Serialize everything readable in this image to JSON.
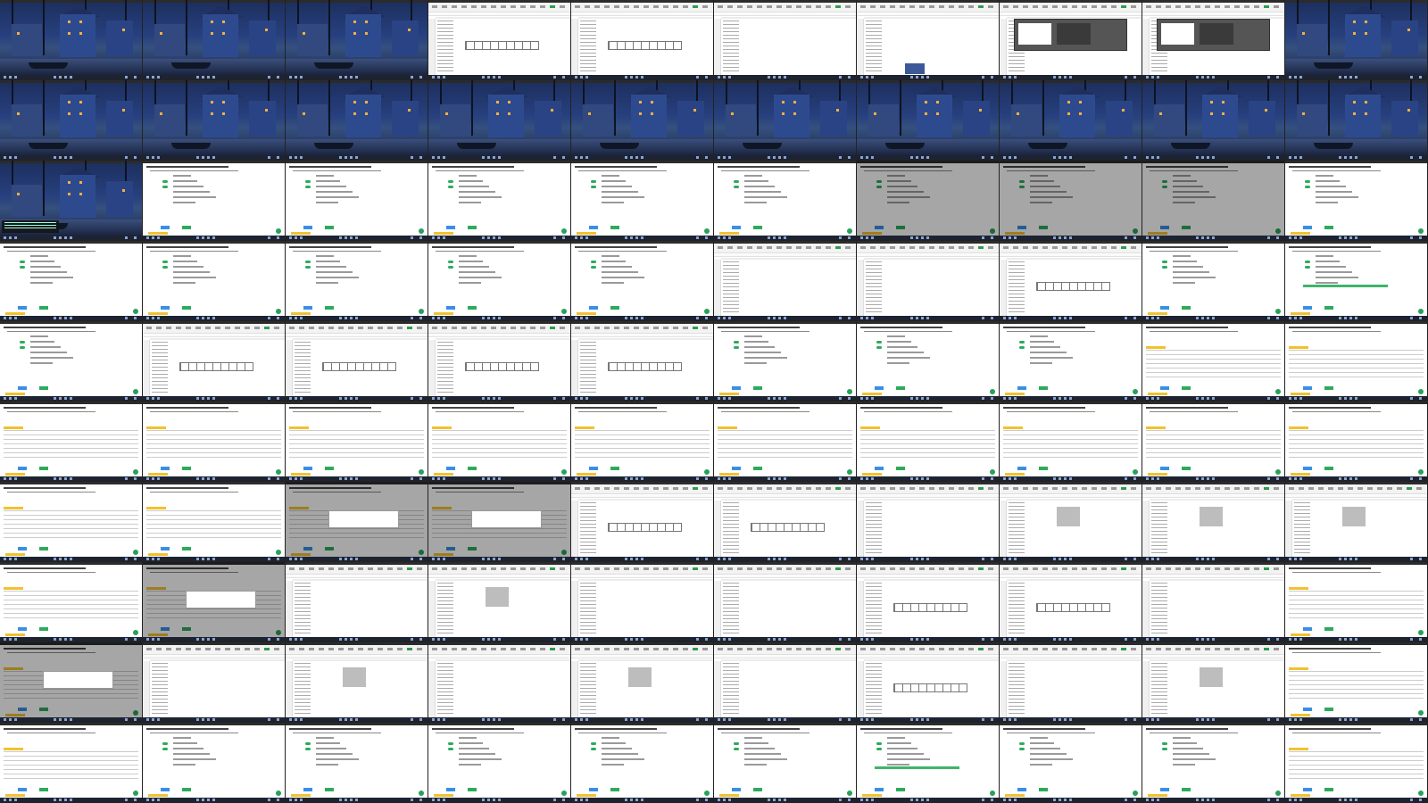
{
  "grid": {
    "frames": [
      {
        "kind": "desktop"
      },
      {
        "kind": "desktop"
      },
      {
        "kind": "desktop"
      },
      {
        "kind": "sheet",
        "variant": "table"
      },
      {
        "kind": "sheet",
        "variant": "table"
      },
      {
        "kind": "sheet",
        "variant": "plain"
      },
      {
        "kind": "sheet",
        "variant": "thumb"
      },
      {
        "kind": "sheet",
        "variant": "dialog"
      },
      {
        "kind": "sheet",
        "variant": "dialog"
      },
      {
        "kind": "desktop"
      },
      {
        "kind": "desktop"
      },
      {
        "kind": "desktop"
      },
      {
        "kind": "desktop"
      },
      {
        "kind": "desktop"
      },
      {
        "kind": "desktop"
      },
      {
        "kind": "desktop"
      },
      {
        "kind": "desktop"
      },
      {
        "kind": "desktop"
      },
      {
        "kind": "desktop"
      },
      {
        "kind": "desktop"
      },
      {
        "kind": "desktop",
        "variant": "term"
      },
      {
        "kind": "form"
      },
      {
        "kind": "form"
      },
      {
        "kind": "form"
      },
      {
        "kind": "form"
      },
      {
        "kind": "form"
      },
      {
        "kind": "form",
        "variant": "shade"
      },
      {
        "kind": "form",
        "variant": "shade"
      },
      {
        "kind": "form",
        "variant": "shade"
      },
      {
        "kind": "form"
      },
      {
        "kind": "form"
      },
      {
        "kind": "form"
      },
      {
        "kind": "form"
      },
      {
        "kind": "form"
      },
      {
        "kind": "form"
      },
      {
        "kind": "sheet",
        "variant": "plain"
      },
      {
        "kind": "sheet",
        "variant": "plain"
      },
      {
        "kind": "sheet",
        "variant": "table"
      },
      {
        "kind": "form"
      },
      {
        "kind": "form",
        "variant": "bar"
      },
      {
        "kind": "form"
      },
      {
        "kind": "sheet",
        "variant": "table"
      },
      {
        "kind": "sheet",
        "variant": "table"
      },
      {
        "kind": "sheet",
        "variant": "table"
      },
      {
        "kind": "sheet",
        "variant": "table"
      },
      {
        "kind": "form"
      },
      {
        "kind": "form"
      },
      {
        "kind": "form"
      },
      {
        "kind": "form",
        "variant": "list"
      },
      {
        "kind": "form",
        "variant": "list"
      },
      {
        "kind": "form",
        "variant": "list"
      },
      {
        "kind": "form",
        "variant": "list"
      },
      {
        "kind": "form",
        "variant": "list"
      },
      {
        "kind": "form",
        "variant": "list"
      },
      {
        "kind": "form",
        "variant": "list"
      },
      {
        "kind": "form",
        "variant": "list"
      },
      {
        "kind": "form",
        "variant": "list"
      },
      {
        "kind": "form",
        "variant": "list"
      },
      {
        "kind": "form",
        "variant": "list"
      },
      {
        "kind": "form",
        "variant": "list"
      },
      {
        "kind": "form",
        "variant": "list"
      },
      {
        "kind": "form",
        "variant": "list"
      },
      {
        "kind": "form",
        "variant": "modal"
      },
      {
        "kind": "form",
        "variant": "modal"
      },
      {
        "kind": "sheet",
        "variant": "table"
      },
      {
        "kind": "sheet",
        "variant": "table"
      },
      {
        "kind": "sheet",
        "variant": "plain"
      },
      {
        "kind": "sheet",
        "variant": "select"
      },
      {
        "kind": "sheet",
        "variant": "select"
      },
      {
        "kind": "sheet",
        "variant": "select"
      },
      {
        "kind": "form",
        "variant": "list"
      },
      {
        "kind": "form",
        "variant": "modal"
      },
      {
        "kind": "sheet",
        "variant": "plain"
      },
      {
        "kind": "sheet",
        "variant": "select"
      },
      {
        "kind": "sheet",
        "variant": "plain"
      },
      {
        "kind": "sheet",
        "variant": "plain"
      },
      {
        "kind": "sheet",
        "variant": "table"
      },
      {
        "kind": "sheet",
        "variant": "table"
      },
      {
        "kind": "sheet",
        "variant": "plain"
      },
      {
        "kind": "form",
        "variant": "list"
      },
      {
        "kind": "form",
        "variant": "modal"
      },
      {
        "kind": "sheet",
        "variant": "plain"
      },
      {
        "kind": "sheet",
        "variant": "select"
      },
      {
        "kind": "sheet",
        "variant": "plain"
      },
      {
        "kind": "sheet",
        "variant": "select"
      },
      {
        "kind": "sheet",
        "variant": "plain"
      },
      {
        "kind": "sheet",
        "variant": "table"
      },
      {
        "kind": "sheet",
        "variant": "plain"
      },
      {
        "kind": "sheet",
        "variant": "select"
      },
      {
        "kind": "form",
        "variant": "list"
      },
      {
        "kind": "form",
        "variant": "list"
      },
      {
        "kind": "form"
      },
      {
        "kind": "form"
      },
      {
        "kind": "form"
      },
      {
        "kind": "form"
      },
      {
        "kind": "form"
      },
      {
        "kind": "form",
        "variant": "bar"
      },
      {
        "kind": "form"
      },
      {
        "kind": "form"
      },
      {
        "kind": "form",
        "variant": "list"
      }
    ]
  },
  "colors": {
    "accent_blue": "#3a8ee6",
    "accent_green": "#2eaa5c",
    "tag_yellow": "#f2c12e",
    "taskbar": "#1d2330"
  },
  "icons": [
    "window-icon",
    "spreadsheet-icon",
    "form-icon"
  ]
}
